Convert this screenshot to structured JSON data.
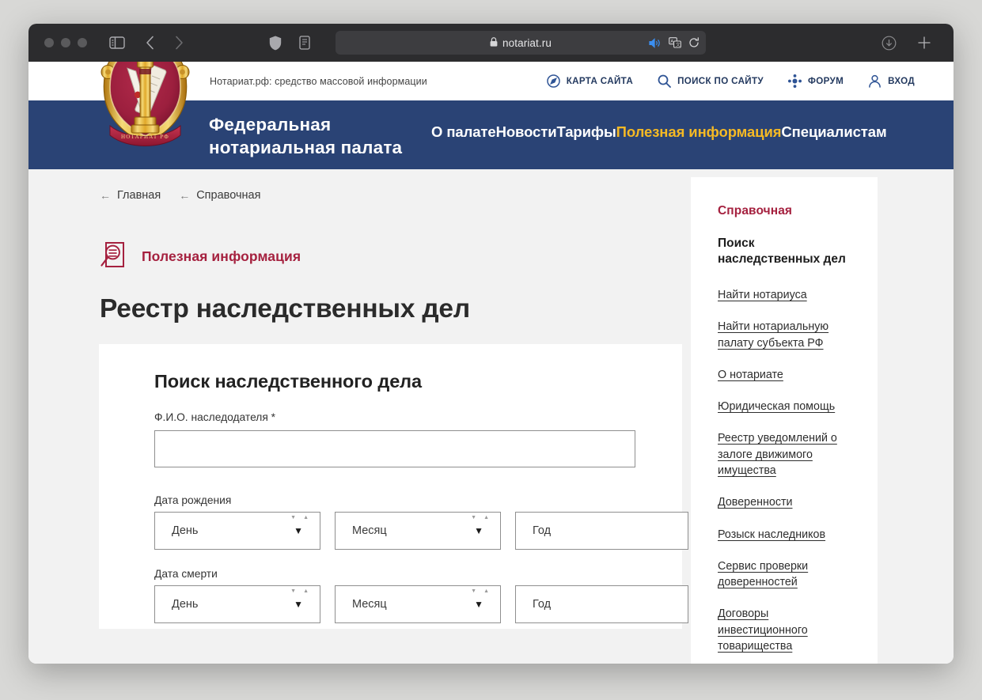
{
  "browser": {
    "url": "notariat.ru",
    "lock_icon": "lock-icon",
    "icons": {
      "sidebar_toggle": "sidebar-toggle-icon",
      "back": "chevron-left-icon",
      "forward": "chevron-right-icon",
      "shield": "shield-icon",
      "reader": "reader-view-icon",
      "speaker": "speaker-playing-icon",
      "translate": "translate-icon",
      "reload": "reload-icon",
      "download": "download-icon",
      "new_tab": "plus-icon"
    }
  },
  "site": {
    "tagline": "Нотариат.рф: средство массовой информации",
    "brand_line1": "Федеральная",
    "brand_line2": "нотариальная палата",
    "topbar_links": [
      {
        "label": "КАРТА САЙТА",
        "icon": "compass-icon"
      },
      {
        "label": "ПОИСК ПО САЙТУ",
        "icon": "search-icon"
      },
      {
        "label": "ФОРУМ",
        "icon": "forum-nodes-icon"
      },
      {
        "label": "ВХОД",
        "icon": "person-icon"
      }
    ],
    "menu": [
      {
        "label": "О палате",
        "active": false
      },
      {
        "label": "Новости",
        "active": false
      },
      {
        "label": "Тарифы",
        "active": false
      },
      {
        "label": "Полезная информация",
        "active": true
      },
      {
        "label": "Специалистам",
        "active": false
      }
    ],
    "nav_blue": "#2a4375",
    "accent_crimson": "#a5213f",
    "accent_gold": "#f5b924"
  },
  "breadcrumb": {
    "arrow": "←",
    "items": [
      {
        "label": "Главная"
      },
      {
        "label": "Справочная"
      }
    ]
  },
  "section": {
    "icon": "document-search-icon",
    "title": "Полезная информация"
  },
  "page": {
    "title": "Реестр наследственных дел"
  },
  "form": {
    "title": "Поиск наследственного дела",
    "fio": {
      "label": "Ф.И.О. наследодателя *",
      "value": "",
      "placeholder": ""
    },
    "birth": {
      "label": "Дата рождения",
      "day": "День",
      "month": "Месяц",
      "year_placeholder": "Год",
      "year_value": ""
    },
    "death": {
      "label": "Дата смерти",
      "day": "День",
      "month": "Месяц",
      "year_placeholder": "Год",
      "year_value": ""
    }
  },
  "sidebar": {
    "heading": "Справочная",
    "active_item": "Поиск наследственных дел",
    "links": [
      {
        "label": "Найти нотариуса"
      },
      {
        "label": "Найти нотариальную палату субъекта РФ"
      },
      {
        "label": "О нотариате"
      },
      {
        "label": "Юридическая помощь"
      },
      {
        "label": "Реестр уведомлений о залоге движимого имущества"
      },
      {
        "label": "Доверенности"
      },
      {
        "label": "Розыск наследников"
      },
      {
        "label": "Сервис проверки доверенностей"
      },
      {
        "label": "Договоры инвестиционного товарищества"
      }
    ]
  }
}
